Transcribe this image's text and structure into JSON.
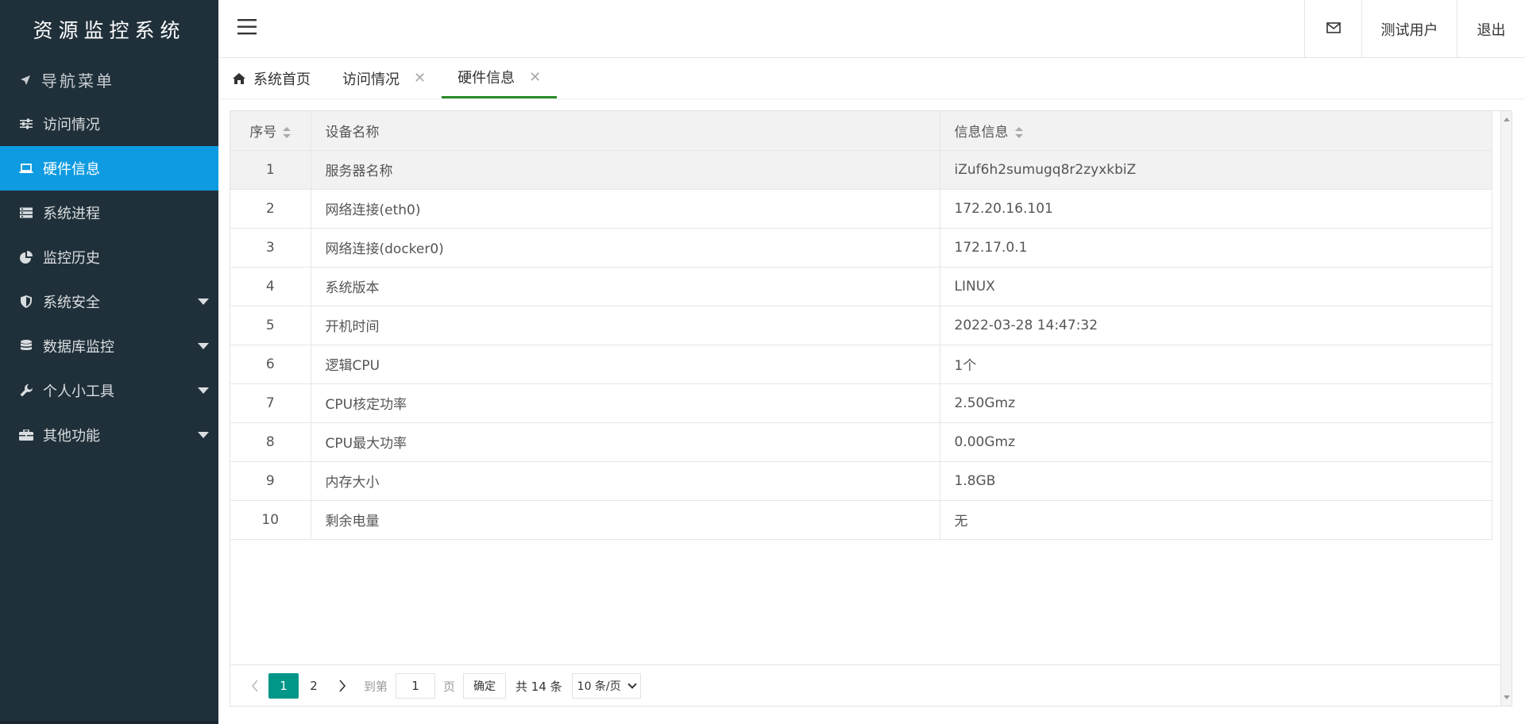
{
  "sidebar": {
    "logo": "资源监控系统",
    "nav_title": "导航菜单",
    "items": [
      {
        "label": "访问情况"
      },
      {
        "label": "硬件信息"
      },
      {
        "label": "系统进程"
      },
      {
        "label": "监控历史"
      },
      {
        "label": "系统安全"
      },
      {
        "label": "数据库监控"
      },
      {
        "label": "个人小工具"
      },
      {
        "label": "其他功能"
      }
    ]
  },
  "header": {
    "user": "测试用户",
    "logout": "退出"
  },
  "tabs": [
    {
      "label": "系统首页"
    },
    {
      "label": "访问情况"
    },
    {
      "label": "硬件信息"
    }
  ],
  "table": {
    "columns": [
      "序号",
      "设备名称",
      "信息信息"
    ],
    "rows": [
      [
        "1",
        "服务器名称",
        "iZuf6h2sumugq8r2zyxkbiZ"
      ],
      [
        "2",
        "网络连接(eth0)",
        "172.20.16.101"
      ],
      [
        "3",
        "网络连接(docker0)",
        "172.17.0.1"
      ],
      [
        "4",
        "系统版本",
        "LINUX"
      ],
      [
        "5",
        "开机时间",
        "2022-03-28 14:47:32"
      ],
      [
        "6",
        "逻辑CPU",
        "1个"
      ],
      [
        "7",
        "CPU核定功率",
        "2.50Gmz"
      ],
      [
        "8",
        "CPU最大功率",
        "0.00Gmz"
      ],
      [
        "9",
        "内存大小",
        "1.8GB"
      ],
      [
        "10",
        "剩余电量",
        "无"
      ]
    ]
  },
  "pager": {
    "pages": [
      "1",
      "2"
    ],
    "goto_label": "到第",
    "goto_value": "1",
    "page_unit": "页",
    "confirm": "确定",
    "total": "共 14 条",
    "page_size": "10 条/页"
  },
  "colors": {
    "sidebar_bg": "#20303a",
    "active_nav": "#0e9be1",
    "active_tab_underline": "#2a8a2a",
    "pager_active": "#009688"
  }
}
